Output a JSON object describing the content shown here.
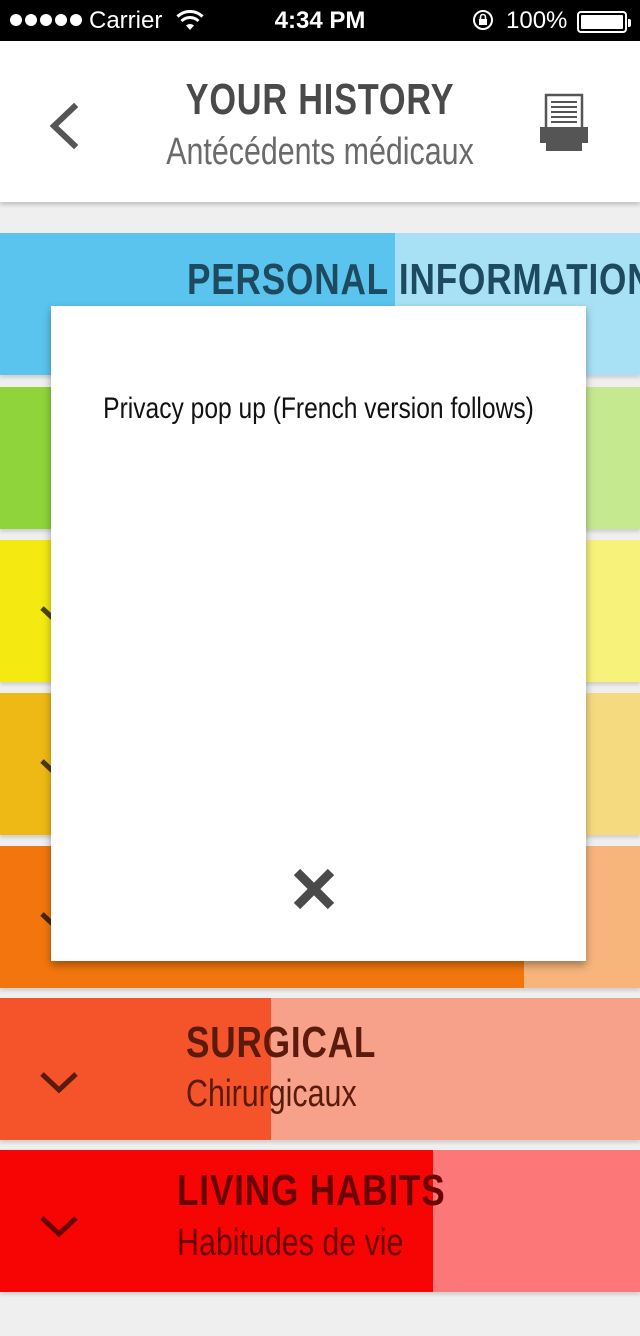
{
  "statusbar": {
    "carrier": "Carrier",
    "time": "4:34 PM",
    "battery": "100%"
  },
  "header": {
    "title": "YOUR HISTORY",
    "subtitle": "Antécédents médicaux",
    "back_icon": "chevron-left-icon",
    "print_icon": "printer-icon"
  },
  "sections": [
    {
      "title": "PERSONAL INFORMATION",
      "subtitle": "",
      "color": "#5ac4ee",
      "light": "#a8e0f6",
      "text_color": "#1d4a5f"
    },
    {
      "title": "",
      "subtitle": "",
      "color": "#8fd43a",
      "light": "#c5e98f",
      "text_color": "#2f4a12"
    },
    {
      "title": "",
      "subtitle": "",
      "color": "#f4ea12",
      "light": "#f6f27a",
      "text_color": "#4a4510"
    },
    {
      "title": "",
      "subtitle": "",
      "color": "#efb915",
      "light": "#f6da80",
      "text_color": "#4a3a10"
    },
    {
      "title": "",
      "subtitle": "",
      "color": "#f2760d",
      "light": "#f7b47b",
      "text_color": "#4a2508"
    },
    {
      "title": "SURGICAL",
      "subtitle": "Chirurgicaux",
      "color": "#f5532a",
      "light": "#f7a18a",
      "text_color": "#5a1a0c"
    },
    {
      "title": "LIVING HABITS",
      "subtitle": "Habitudes de vie",
      "color": "#f70505",
      "light": "#fc7878",
      "text_color": "#6a0404"
    }
  ],
  "modal": {
    "message": "Privacy pop up (French version follows)",
    "close_icon": "close-icon"
  }
}
